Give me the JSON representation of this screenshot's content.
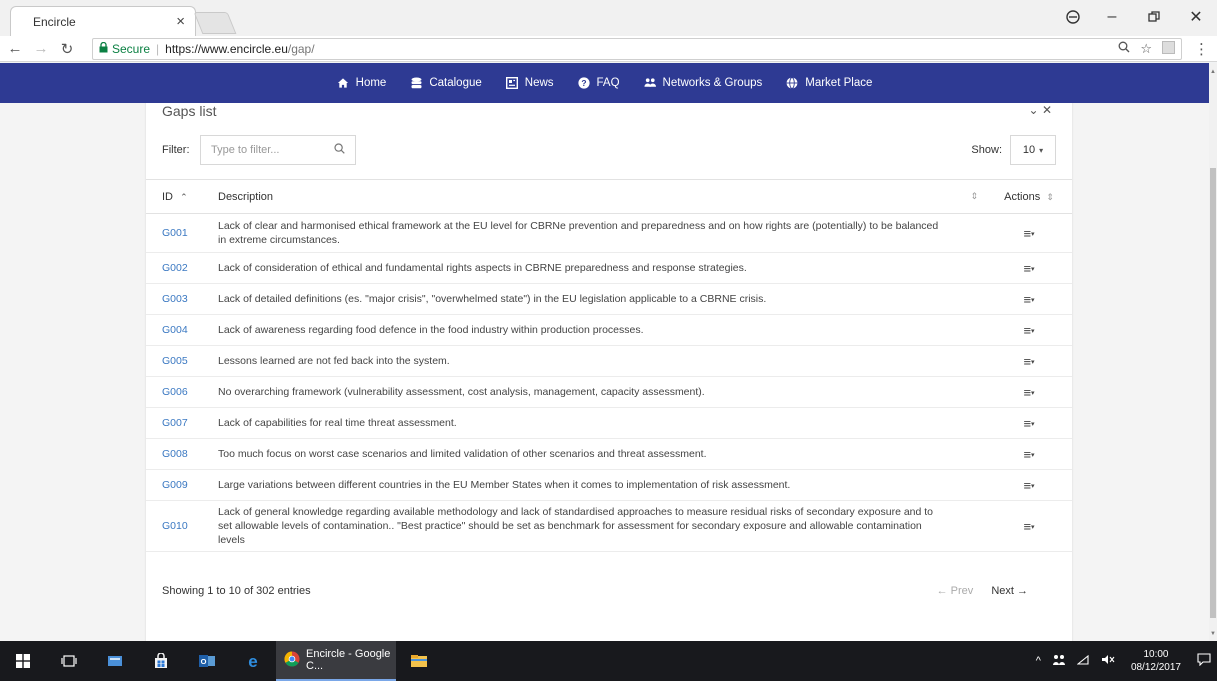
{
  "browser": {
    "tab_title": "Encircle",
    "tab_close": "×",
    "security_label": "Secure",
    "url_host": "https://www.encircle.eu",
    "url_path": "/gap/"
  },
  "nav": {
    "items": [
      {
        "label": "Home",
        "icon": "home-icon"
      },
      {
        "label": "Catalogue",
        "icon": "database-icon"
      },
      {
        "label": "News",
        "icon": "newspaper-icon"
      },
      {
        "label": "FAQ",
        "icon": "question-icon"
      },
      {
        "label": "Networks & Groups",
        "icon": "people-icon"
      },
      {
        "label": "Market Place",
        "icon": "globe-icon"
      }
    ],
    "background": "#2e3a93"
  },
  "card": {
    "title": "Gaps list",
    "filter_label": "Filter:",
    "filter_placeholder": "Type to filter...",
    "show_label": "Show:",
    "show_value": "10"
  },
  "table": {
    "columns": {
      "id": "ID",
      "description": "Description",
      "actions": "Actions"
    },
    "rows": [
      {
        "id": "G001",
        "desc": "Lack of clear and harmonised ethical framework at the EU level for CBRNe prevention and preparedness and on how rights are (potentially) to be balanced in extreme circumstances."
      },
      {
        "id": "G002",
        "desc": "Lack of consideration of ethical and fundamental rights aspects in CBRNE preparedness and response strategies."
      },
      {
        "id": "G003",
        "desc": "Lack of detailed definitions (es. \"major crisis\", \"overwhelmed state\") in the EU legislation applicable to a CBRNE crisis."
      },
      {
        "id": "G004",
        "desc": "Lack of awareness regarding food defence in the food industry within production processes."
      },
      {
        "id": "G005",
        "desc": "Lessons learned are not fed back into the system."
      },
      {
        "id": "G006",
        "desc": "No overarching framework (vulnerability assessment, cost analysis, management, capacity assessment)."
      },
      {
        "id": "G007",
        "desc": "Lack of capabilities for real time threat assessment."
      },
      {
        "id": "G008",
        "desc": "Too much focus on worst case scenarios and limited validation of other scenarios and threat assessment."
      },
      {
        "id": "G009",
        "desc": "Large variations between different countries in the EU Member States when it comes to implementation of risk assessment."
      },
      {
        "id": "G010",
        "desc": "Lack of general knowledge regarding available methodology and lack of standardised approaches to measure residual risks of secondary exposure and to set allowable levels of contamination.. \"Best practice\" should be set as benchmark for assessment for secondary exposure and allowable contamination levels"
      }
    ]
  },
  "footer": {
    "info": "Showing 1 to 10 of 302 entries",
    "prev": "← Prev",
    "next": "Next →"
  },
  "taskbar": {
    "chrome_label": "Encircle - Google C...",
    "time": "10:00",
    "date": "08/12/2017"
  }
}
